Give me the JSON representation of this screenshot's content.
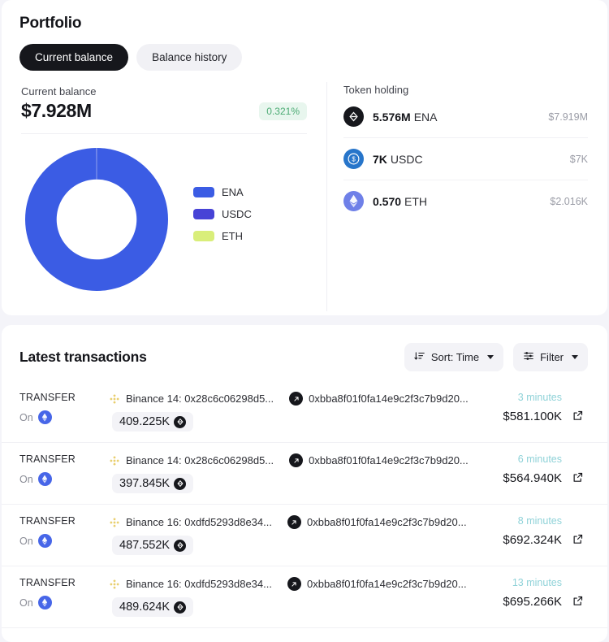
{
  "portfolio": {
    "title": "Portfolio",
    "tabs": [
      {
        "label": "Current balance",
        "active": true
      },
      {
        "label": "Balance history",
        "active": false
      }
    ],
    "balance": {
      "label": "Current balance",
      "amount": "$7.928M",
      "change": "0.321%",
      "change_color": "#4cab74",
      "change_bg": "#e8f6ee"
    },
    "legend": [
      {
        "label": "ENA",
        "color": "#3b5ce4"
      },
      {
        "label": "USDC",
        "color": "#4743d6"
      },
      {
        "label": "ETH",
        "color": "#d9ee7a"
      }
    ],
    "token_holding": {
      "title": "Token holding",
      "rows": [
        {
          "icon": "ena-token-icon",
          "amount": "5.576M",
          "symbol": "ENA",
          "usd": "$7.919M"
        },
        {
          "icon": "usdc-token-icon",
          "amount": "7K",
          "symbol": "USDC",
          "usd": "$7K"
        },
        {
          "icon": "eth-token-icon",
          "amount": "0.570",
          "symbol": "ETH",
          "usd": "$2.016K"
        }
      ]
    }
  },
  "chart_data": {
    "type": "pie",
    "title": "Current balance",
    "categories": [
      "ENA",
      "USDC",
      "ETH"
    ],
    "values": [
      7.919,
      0.007,
      0.002016
    ],
    "value_unit": "millions USD",
    "percentages": [
      99.89,
      0.09,
      0.03
    ],
    "colors": [
      "#3b5ce4",
      "#4743d6",
      "#d9ee7a"
    ],
    "donut": true,
    "inner_radius_ratio": 0.56,
    "legend_position": "right",
    "total": "$7.928M"
  },
  "transactions": {
    "title": "Latest transactions",
    "sort": {
      "label": "Sort: Time",
      "icon": "sort-icon"
    },
    "filter": {
      "label": "Filter",
      "icon": "filter-icon"
    },
    "rows": [
      {
        "type": "TRANSFER",
        "on_label": "On",
        "chain_icon": "ethereum-chain-icon",
        "from": "Binance 14: 0x28c6c06298d5...",
        "to": "0xbba8f01f0fa14e9c2f3c7b9d20...",
        "amount": "409.225K",
        "time": "3 minutes",
        "usd": "$581.100K"
      },
      {
        "type": "TRANSFER",
        "on_label": "On",
        "chain_icon": "ethereum-chain-icon",
        "from": "Binance 14: 0x28c6c06298d5...",
        "to": "0xbba8f01f0fa14e9c2f3c7b9d20...",
        "amount": "397.845K",
        "time": "6 minutes",
        "usd": "$564.940K"
      },
      {
        "type": "TRANSFER",
        "on_label": "On",
        "chain_icon": "ethereum-chain-icon",
        "from": "Binance 16: 0xdfd5293d8e34...",
        "to": "0xbba8f01f0fa14e9c2f3c7b9d20...",
        "amount": "487.552K",
        "time": "8 minutes",
        "usd": "$692.324K"
      },
      {
        "type": "TRANSFER",
        "on_label": "On",
        "chain_icon": "ethereum-chain-icon",
        "from": "Binance 16: 0xdfd5293d8e34...",
        "to": "0xbba8f01f0fa14e9c2f3c7b9d20...",
        "amount": "489.624K",
        "time": "13 minutes",
        "usd": "$695.266K"
      }
    ]
  }
}
